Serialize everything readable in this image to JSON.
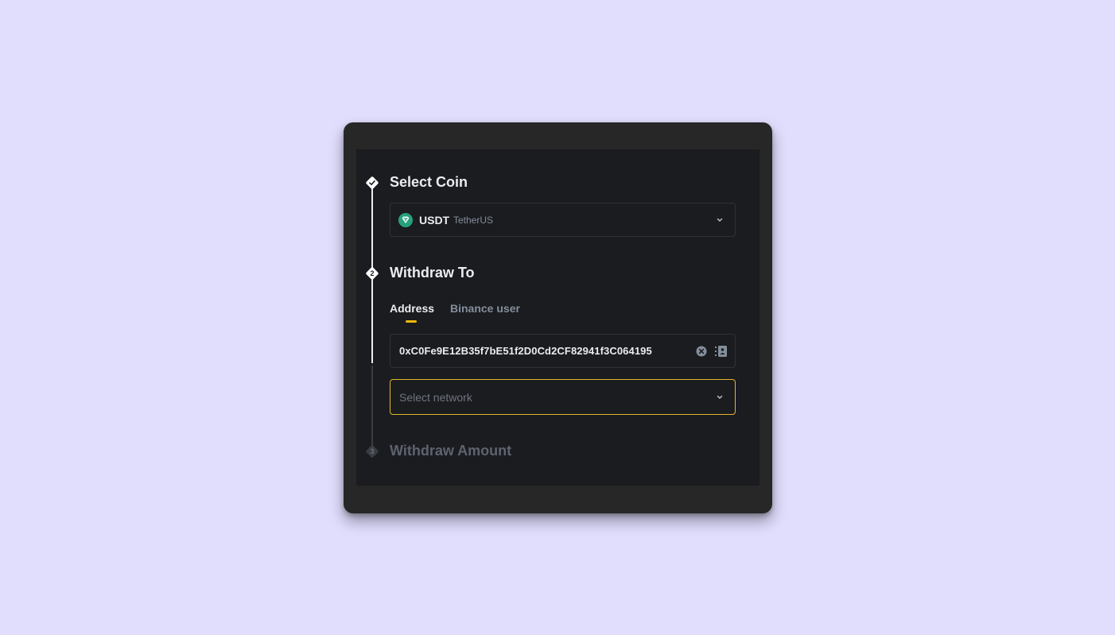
{
  "steps": {
    "step1": {
      "title": "Select Coin",
      "status": "completed"
    },
    "step2": {
      "number": "2",
      "title": "Withdraw To",
      "status": "active"
    },
    "step3": {
      "number": "3",
      "title": "Withdraw Amount",
      "status": "inactive"
    }
  },
  "coin_select": {
    "symbol": "USDT",
    "name": "TetherUS",
    "icon": "tether-logo-icon"
  },
  "withdraw_to": {
    "tabs": [
      {
        "label": "Address",
        "active": true
      },
      {
        "label": "Binance user",
        "active": false
      }
    ],
    "address_value": "0xC0Fe9E12B35f7bE51f2D0Cd2CF82941f3C064195",
    "network_placeholder": "Select network"
  },
  "colors": {
    "page_background": "#e0ddfd",
    "panel_background": "#1b1c20",
    "accent_yellow": "#f0b90b",
    "focus_border": "#e0b62c",
    "tether_green": "#26a17b"
  }
}
